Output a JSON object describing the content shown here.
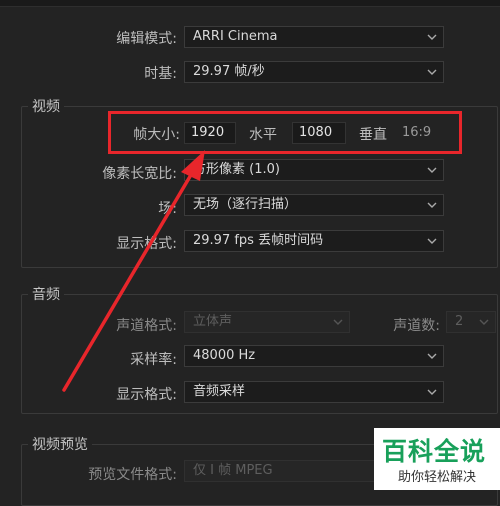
{
  "sequence_settings": {
    "editing_mode": {
      "label": "编辑模式:",
      "value": "ARRI Cinema"
    },
    "timebase": {
      "label": "时基:",
      "value": "29.97  帧/秒"
    }
  },
  "video": {
    "title": "视频",
    "frame_size": {
      "label": "帧大小:",
      "width": "1920",
      "horizontal_label": "水平",
      "height": "1080",
      "vertical_label": "垂直",
      "aspect": "16:9"
    },
    "pixel_aspect": {
      "label": "像素长宽比:",
      "value": "方形像素 (1.0)"
    },
    "fields": {
      "label": "场:",
      "value": "无场（逐行扫描）"
    },
    "display_format": {
      "label": "显示格式:",
      "value": "29.97 fps 丢帧时间码"
    }
  },
  "audio": {
    "title": "音频",
    "channel_format": {
      "label": "声道格式:",
      "value": "立体声"
    },
    "channel_count": {
      "label": "声道数:",
      "value": "2"
    },
    "sample_rate": {
      "label": "采样率:",
      "value": "48000 Hz"
    },
    "display_format": {
      "label": "显示格式:",
      "value": "音频采样"
    }
  },
  "video_preview": {
    "title": "视频预览",
    "preview_file_format": {
      "label": "预览文件格式:",
      "value": "仅 I 帧 MPEG"
    }
  },
  "watermark": {
    "main": "百科全说",
    "sub": "助你轻松解决"
  },
  "colors": {
    "highlight": "#e8262b",
    "background": "#232323",
    "watermark_green": "#18a05a"
  }
}
